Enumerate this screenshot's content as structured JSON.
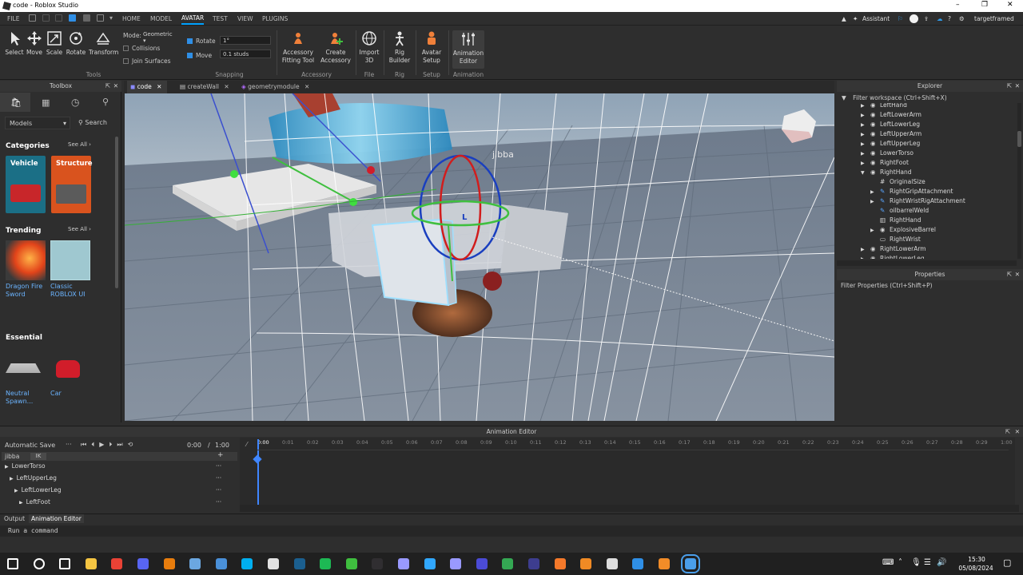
{
  "window": {
    "title": "code - Roblox Studio",
    "controls": [
      "–",
      "❐",
      "✕"
    ]
  },
  "menu": {
    "file": "FILE",
    "tabs": [
      "HOME",
      "MODEL",
      "AVATAR",
      "TEST",
      "VIEW",
      "PLUGINS"
    ],
    "active_tab": "AVATAR",
    "assistant": "Assistant",
    "user": "targetframed"
  },
  "ribbon": {
    "tools": [
      {
        "label": "Select",
        "icon": "cursor-icon"
      },
      {
        "label": "Move",
        "icon": "move-icon"
      },
      {
        "label": "Scale",
        "icon": "scale-icon"
      },
      {
        "label": "Rotate",
        "icon": "rotate-icon"
      },
      {
        "label": "Transform",
        "icon": "transform-icon"
      }
    ],
    "tools_group": "Tools",
    "mode_label": "Mode:",
    "mode_value": "Geometric",
    "collisions": "Collisions",
    "join_surfaces": "Join Surfaces",
    "rotate_label": "Rotate",
    "rotate_value": "1°",
    "move_label": "Move",
    "move_value": "0.1 studs",
    "snapping_group": "Snapping",
    "accessory": [
      {
        "label1": "Accessory",
        "label2": "Fitting Tool"
      },
      {
        "label1": "Create",
        "label2": "Accessory"
      }
    ],
    "accessory_group": "Accessory",
    "import": {
      "label1": "Import",
      "label2": "3D"
    },
    "file_group": "File",
    "rig": {
      "label1": "Rig",
      "label2": "Builder"
    },
    "rig_group": "Rig",
    "avatar_setup": {
      "label1": "Avatar",
      "label2": "Setup"
    },
    "setup_group": "Setup",
    "anim_editor": {
      "label1": "Animation",
      "label2": "Editor"
    },
    "animation_group": "Animation"
  },
  "toolbox": {
    "title": "Toolbox",
    "dropdown": "Models",
    "search": "Search",
    "categories_title": "Categories",
    "see_all": "See All ›",
    "categories": [
      {
        "label": "Vehicle",
        "color": "#1b6f86"
      },
      {
        "label": "Structure",
        "color": "#d9531e"
      }
    ],
    "trending_title": "Trending",
    "trending": [
      {
        "line1": "Dragon Fire",
        "line2": "Sword"
      },
      {
        "line1": "Classic",
        "line2": "ROBLOX UI"
      }
    ],
    "essential_title": "Essential",
    "essential": [
      {
        "line1": "Neutral",
        "line2": "Spawn..."
      },
      {
        "line1": "Car",
        "line2": ""
      }
    ]
  },
  "doc_tabs": [
    {
      "label": "code",
      "active": true
    },
    {
      "label": "createWall",
      "active": false
    },
    {
      "label": "geometrymodule",
      "active": false
    }
  ],
  "viewport": {
    "rig_name": "jibba",
    "marker": "L"
  },
  "explorer": {
    "title": "Explorer",
    "filter": "Filter workspace (Ctrl+Shift+X)",
    "items": [
      {
        "label": "LeftHand",
        "arrow": "▶"
      },
      {
        "label": "LeftLowerArm",
        "arrow": "▶"
      },
      {
        "label": "LeftLowerLeg",
        "arrow": "▶"
      },
      {
        "label": "LeftUpperArm",
        "arrow": "▶"
      },
      {
        "label": "LeftUpperLeg",
        "arrow": "▶"
      },
      {
        "label": "LowerTorso",
        "arrow": "▶"
      },
      {
        "label": "RightFoot",
        "arrow": "▶"
      },
      {
        "label": "RightHand",
        "arrow": "▼"
      },
      {
        "label": "OriginalSize",
        "arrow": ""
      },
      {
        "label": "RightGripAttachment",
        "arrow": "▶"
      },
      {
        "label": "RightWristRigAttachment",
        "arrow": "▶"
      },
      {
        "label": "oilbarrelWeld",
        "arrow": ""
      },
      {
        "label": "RightHand",
        "arrow": ""
      },
      {
        "label": "ExplosiveBarrel",
        "arrow": "▶"
      },
      {
        "label": "RightWrist",
        "arrow": ""
      },
      {
        "label": "RightLowerArm",
        "arrow": "▶"
      },
      {
        "label": "RightLowerLeg",
        "arrow": "▶"
      }
    ]
  },
  "properties": {
    "title": "Properties",
    "filter": "Filter Properties (Ctrl+Shift+P)"
  },
  "animation": {
    "title": "Animation Editor",
    "autosave": "Automatic Save",
    "time_current": "0:00",
    "time_sep": "/",
    "time_total": "1:00",
    "rig": "jibba",
    "ik": "IK",
    "tracks": [
      {
        "label": "LowerTorso",
        "indent": 0
      },
      {
        "label": "LeftUpperLeg",
        "indent": 1
      },
      {
        "label": "LeftLowerLeg",
        "indent": 2
      },
      {
        "label": "LeftFoot",
        "indent": 3
      }
    ],
    "ruler": [
      "0:00",
      "0:01",
      "0:02",
      "0:03",
      "0:04",
      "0:05",
      "0:06",
      "0:07",
      "0:08",
      "0:09",
      "0:10",
      "0:11",
      "0:12",
      "0:13",
      "0:14",
      "0:15",
      "0:16",
      "0:17",
      "0:18",
      "0:19",
      "0:20",
      "0:21",
      "0:22",
      "0:23",
      "0:24",
      "0:25",
      "0:26",
      "0:27",
      "0:28",
      "0:29",
      "1:00"
    ]
  },
  "output": {
    "tabs": [
      "Output",
      "Animation Editor"
    ],
    "command": "Run a command"
  },
  "taskbar": {
    "time": "15:30",
    "date": "05/08/2024",
    "icons": [
      {
        "name": "windows-start-icon",
        "color": "#ffffff"
      },
      {
        "name": "search-icon",
        "color": "#ffffff"
      },
      {
        "name": "task-view-icon",
        "color": "#ffffff"
      },
      {
        "name": "file-explorer-icon",
        "color": "#f5c542"
      },
      {
        "name": "chrome-icon",
        "color": "#e94235"
      },
      {
        "name": "discord-icon",
        "color": "#5865f2"
      },
      {
        "name": "blender-icon",
        "color": "#e87d0d"
      },
      {
        "name": "notepad-icon",
        "color": "#6ba7e0"
      },
      {
        "name": "calculator-icon",
        "color": "#4a90d9"
      },
      {
        "name": "skype-icon",
        "color": "#00aff0"
      },
      {
        "name": "roblox-player-icon",
        "color": "#e2e2e2"
      },
      {
        "name": "steam-icon",
        "color": "#1b5f8f"
      },
      {
        "name": "spotify-icon",
        "color": "#1db954"
      },
      {
        "name": "spotify-green-icon",
        "color": "#3fbf3f"
      },
      {
        "name": "obs-icon",
        "color": "#302e31"
      },
      {
        "name": "after-effects-icon",
        "color": "#9999ff"
      },
      {
        "name": "photoshop-icon",
        "color": "#31a8ff"
      },
      {
        "name": "premiere-icon",
        "color": "#9999ff"
      },
      {
        "name": "vpn-icon",
        "color": "#4b4bd6"
      },
      {
        "name": "chrome-2-icon",
        "color": "#34a853"
      },
      {
        "name": "roblox-icon",
        "color": "#3d3d8f"
      },
      {
        "name": "blender-2-icon",
        "color": "#f5792a"
      },
      {
        "name": "vlc-icon",
        "color": "#f08a24"
      },
      {
        "name": "uplay-icon",
        "color": "#dddddd"
      },
      {
        "name": "mail-icon",
        "color": "#2f8fe6"
      },
      {
        "name": "fl-studio-icon",
        "color": "#f28c28"
      },
      {
        "name": "roblox-studio-icon",
        "color": "#4a9eea"
      }
    ]
  },
  "colors": {
    "accent": "#00a2ff",
    "panel": "#2e2e2e",
    "viewport_sky": "#95a7b8",
    "baseplate": "#7b8796"
  }
}
